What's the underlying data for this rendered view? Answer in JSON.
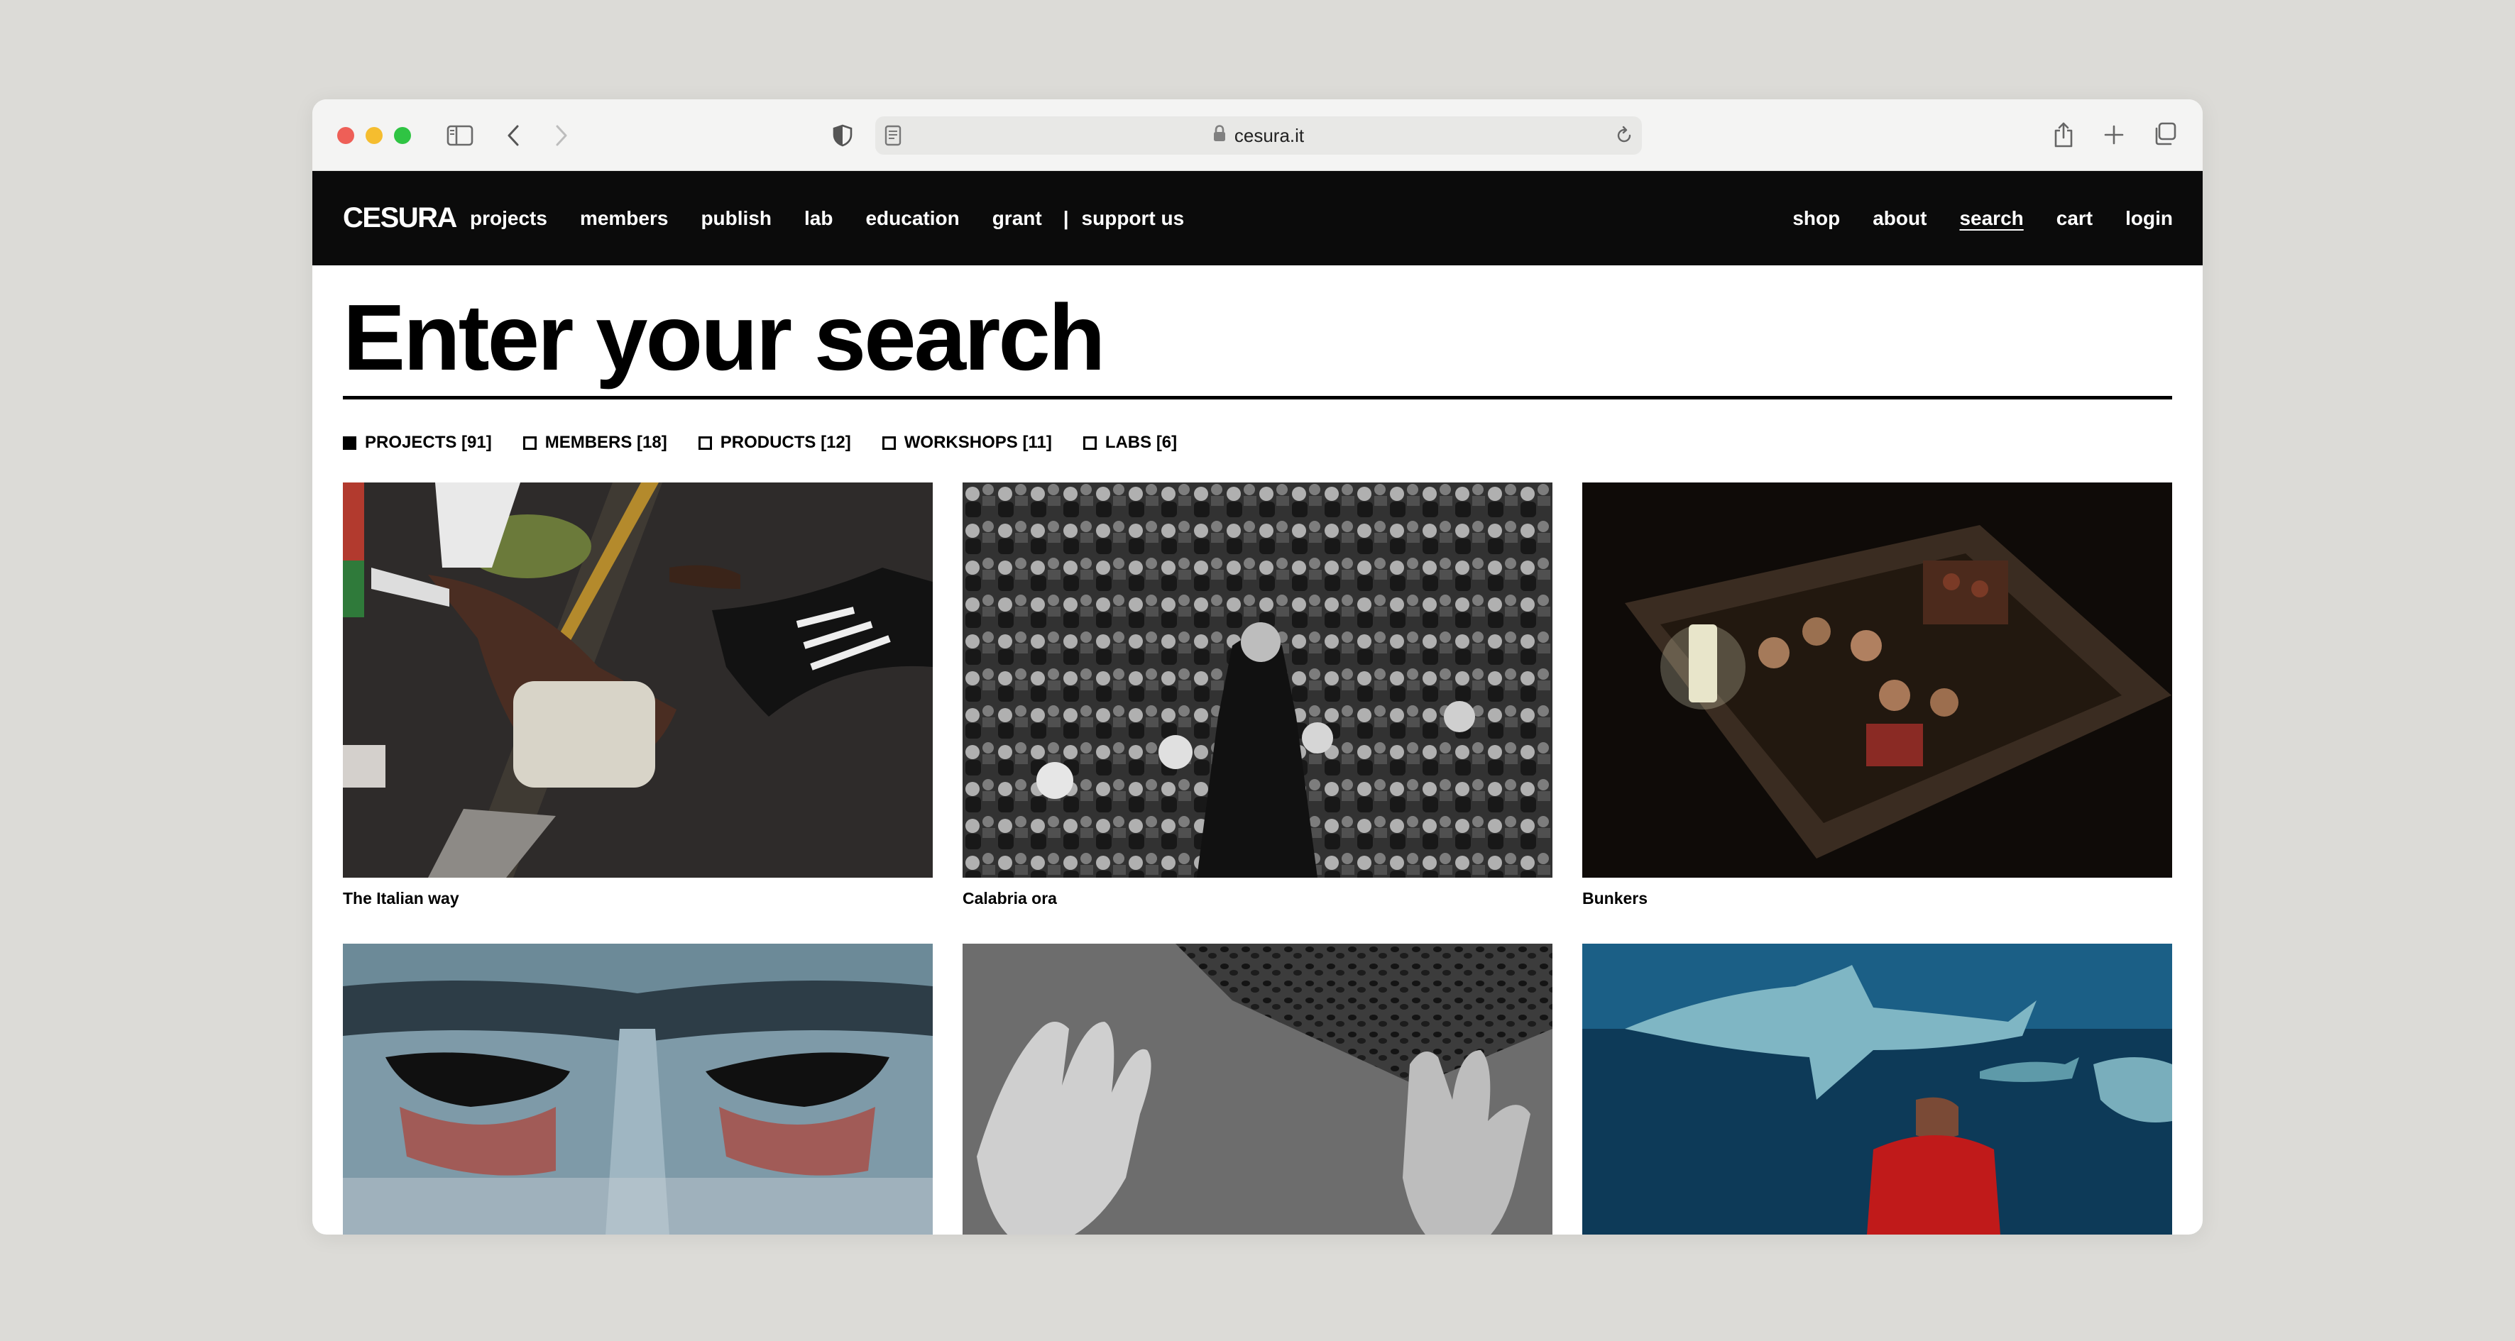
{
  "browser": {
    "url": "cesura.it"
  },
  "site": {
    "logo": "CESURA",
    "nav_left": [
      "projects",
      "members",
      "publish",
      "lab",
      "education",
      "grant"
    ],
    "separator": "|",
    "support": "support us",
    "nav_right": [
      "shop",
      "about",
      "search",
      "cart",
      "login"
    ],
    "active_item": "search"
  },
  "page": {
    "heading": "Enter your search"
  },
  "filters": [
    {
      "label": "PROJECTS [91]",
      "checked": true
    },
    {
      "label": "MEMBERS [18]",
      "checked": false
    },
    {
      "label": "PRODUCTS [12]",
      "checked": false
    },
    {
      "label": "WORKSHOPS [11]",
      "checked": false
    },
    {
      "label": "LABS [6]",
      "checked": false
    }
  ],
  "results": [
    {
      "title": "The Italian way"
    },
    {
      "title": "Calabria ora"
    },
    {
      "title": "Bunkers"
    },
    {
      "title": ""
    },
    {
      "title": ""
    },
    {
      "title": ""
    }
  ],
  "colors": {
    "nav_bg": "#0b0b0b",
    "page_bg": "#ffffff",
    "outer_bg": "#dcdbd7"
  }
}
